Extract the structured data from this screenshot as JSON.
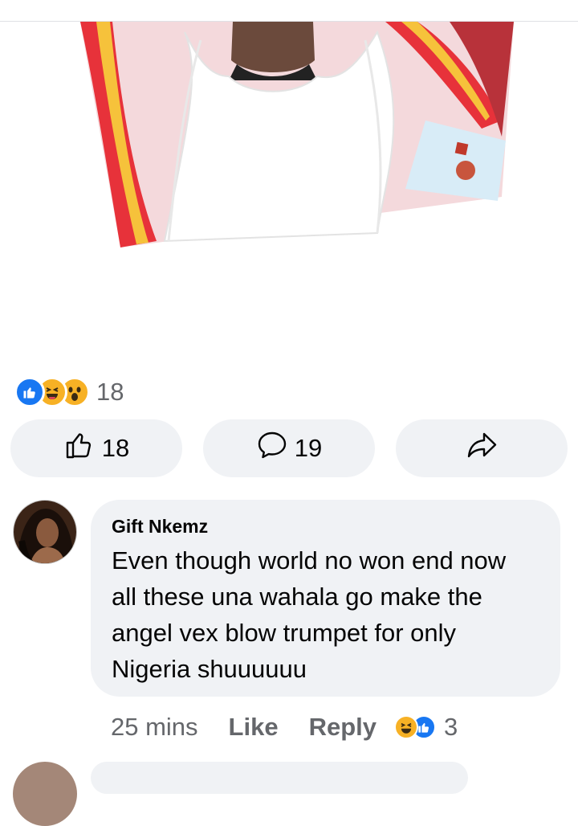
{
  "post": {
    "reaction_icons": [
      "like-icon",
      "haha-icon",
      "wow-icon"
    ],
    "reaction_count": "18"
  },
  "actions": {
    "like_count": "18",
    "comment_count": "19",
    "share_icon": "share-icon"
  },
  "comment": {
    "author": "Gift Nkemz",
    "text": "Even though world no won end now\nall these una wahala go make the\nangel vex blow trumpet for only\nNigeria shuuuuuu",
    "time": "25 mins",
    "like_label": "Like",
    "reply_label": "Reply",
    "reaction_icons": [
      "haha-icon",
      "like-icon"
    ],
    "reaction_count": "3"
  },
  "colors": {
    "facebook_blue": "#1877f2",
    "reaction_yellow": "#f7b125",
    "bubble_gray": "#f0f2f5",
    "muted_text": "#65676b"
  }
}
